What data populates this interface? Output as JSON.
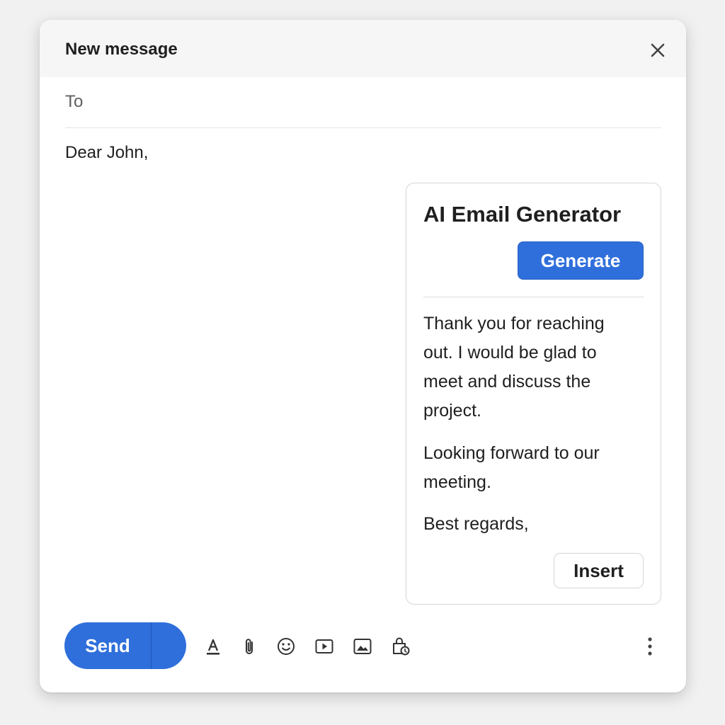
{
  "window": {
    "title": "New message"
  },
  "compose": {
    "to_label": "To",
    "body": "Dear John,"
  },
  "ai_panel": {
    "title": "AI Email Generator",
    "generate_label": "Generate",
    "paragraphs": [
      "Thank you for reaching out. I would be glad to meet and discuss the project.",
      "Looking forward to our meeting.",
      "Best regards,"
    ],
    "insert_label": "Insert"
  },
  "toolbar": {
    "send_label": "Send",
    "icons": [
      "format-text-icon",
      "attach-icon",
      "emoji-icon",
      "video-icon",
      "image-icon",
      "confidential-mode-icon",
      "more-options-icon"
    ]
  },
  "colors": {
    "accent": "#2f6fdb",
    "header_bg": "#f6f6f6",
    "text": "#1f1f1f",
    "muted_text": "#5f5f5f"
  }
}
